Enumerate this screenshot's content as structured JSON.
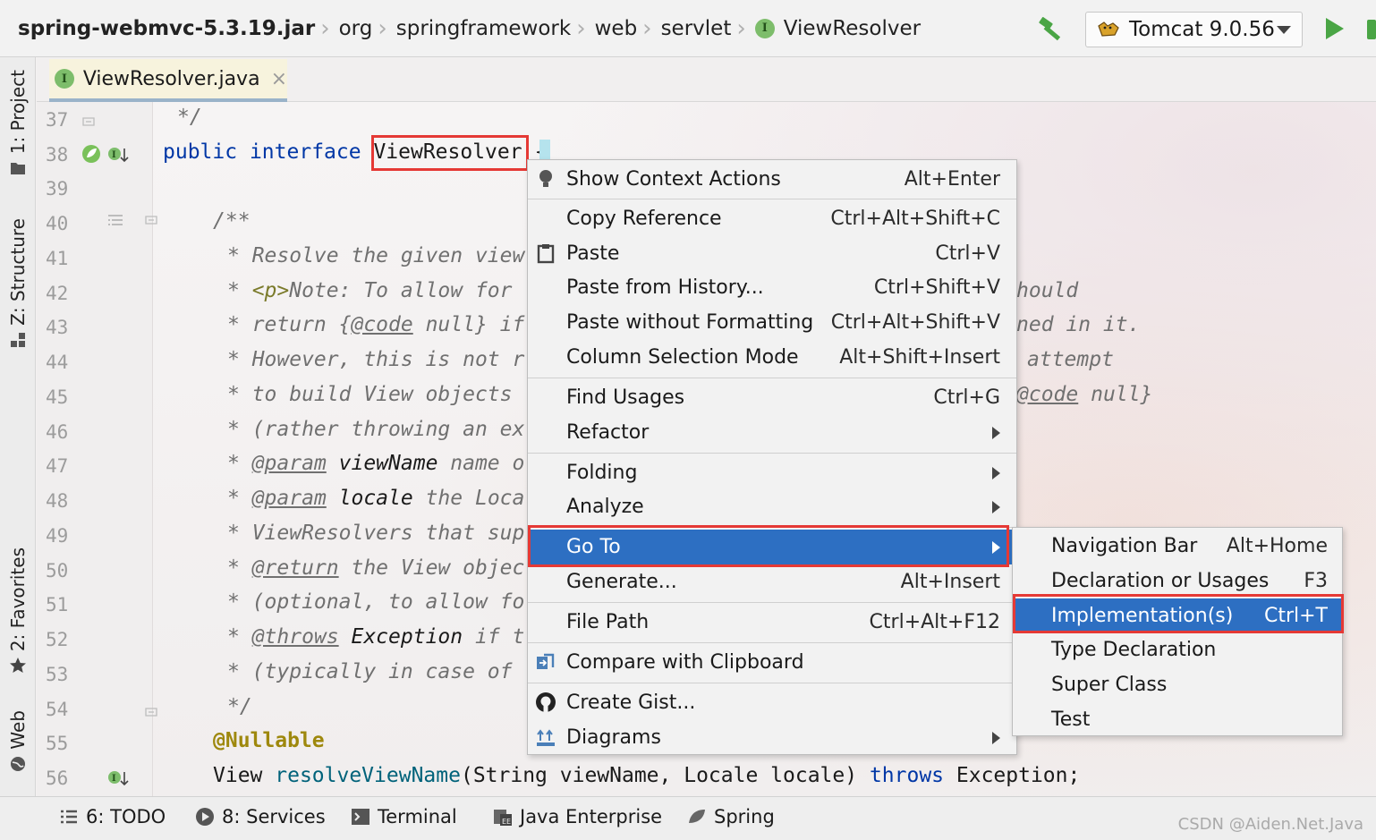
{
  "breadcrumb": {
    "items": [
      "spring-webmvc-5.3.19.jar",
      "org",
      "springframework",
      "web",
      "servlet",
      "ViewResolver"
    ],
    "iface_badge": "I"
  },
  "toolbar": {
    "run_config": "Tomcat 9.0.56"
  },
  "left_tabs": {
    "project": "1: Project",
    "structure": "Z: Structure",
    "favorites": "2: Favorites",
    "web": "Web"
  },
  "editor": {
    "tab_title": "ViewResolver.java",
    "tab_close": "×",
    "line_numbers": [
      "37",
      "38",
      "39",
      "40",
      "41",
      "42",
      "43",
      "44",
      "45",
      "46",
      "47",
      "48",
      "49",
      "50",
      "51",
      "52",
      "53",
      "54",
      "55",
      "56"
    ],
    "lines": {
      "l37": "*/",
      "l38_kw1": "public",
      "l38_kw2": "interface",
      "l38_name": "ViewResolver",
      "l38_brace": "{",
      "l40": "/**",
      "l41": "* Resolve the given view",
      "l42_a": "* ",
      "l42_tag": "<p>",
      "l42_b": "Note: To allow for",
      "l42_tail": "hould",
      "l43_a": "* return {",
      "l43_code": "@code",
      "l43_b": " null} if",
      "l43_tail": "ned in it.",
      "l44": "* However, this is not r",
      "l44_tail": "attempt",
      "l45": "* to build View objects",
      "l45_tail_code": "@code",
      "l45_tail_rest": " null}",
      "l46": "* (rather throwing an ex",
      "l47_a": "* ",
      "l47_tag": "@param",
      "l47_b": " viewName",
      "l47_c": " name o",
      "l48_a": "* ",
      "l48_tag": "@param",
      "l48_b": " locale",
      "l48_c": " the Loca",
      "l49": "* ViewResolvers that sup",
      "l50_a": "* ",
      "l50_tag": "@return",
      "l50_b": " the View objec",
      "l51": "* (optional, to allow fo",
      "l52_a": "* ",
      "l52_tag": "@throws",
      "l52_b": " Exception",
      "l52_c": " if t",
      "l53": "* (typically in case of",
      "l54": "*/",
      "l55": "@Nullable",
      "l56_a": "View ",
      "l56_method": "resolveViewName",
      "l56_b": "(String viewName, Locale locale) ",
      "l56_kw": "throws",
      "l56_c": " Exception;"
    }
  },
  "context_menu": {
    "items": [
      {
        "label": "Show Context Actions",
        "shortcut": "Alt+Enter"
      },
      {
        "label": "Copy Reference",
        "shortcut": "Ctrl+Alt+Shift+C"
      },
      {
        "label": "Paste",
        "shortcut": "Ctrl+V"
      },
      {
        "label": "Paste from History...",
        "shortcut": "Ctrl+Shift+V"
      },
      {
        "label": "Paste without Formatting",
        "shortcut": "Ctrl+Alt+Shift+V"
      },
      {
        "label": "Column Selection Mode",
        "shortcut": "Alt+Shift+Insert"
      },
      {
        "label": "Find Usages",
        "shortcut": "Ctrl+G"
      },
      {
        "label": "Refactor",
        "shortcut": ""
      },
      {
        "label": "Folding",
        "shortcut": ""
      },
      {
        "label": "Analyze",
        "shortcut": ""
      },
      {
        "label": "Go To",
        "shortcut": ""
      },
      {
        "label": "Generate...",
        "shortcut": "Alt+Insert"
      },
      {
        "label": "File Path",
        "shortcut": "Ctrl+Alt+F12"
      },
      {
        "label": "Compare with Clipboard",
        "shortcut": ""
      },
      {
        "label": "Create Gist...",
        "shortcut": ""
      },
      {
        "label": "Diagrams",
        "shortcut": ""
      }
    ]
  },
  "goto_submenu": {
    "items": [
      {
        "label": "Navigation Bar",
        "shortcut": "Alt+Home"
      },
      {
        "label": "Declaration or Usages",
        "shortcut": "F3"
      },
      {
        "label": "Implementation(s)",
        "shortcut": "Ctrl+T"
      },
      {
        "label": "Type Declaration",
        "shortcut": ""
      },
      {
        "label": "Super Class",
        "shortcut": ""
      },
      {
        "label": "Test",
        "shortcut": ""
      }
    ]
  },
  "bottom_tabs": {
    "todo": "6: TODO",
    "services": "8: Services",
    "terminal": "Terminal",
    "java_enterprise": "Java Enterprise",
    "spring": "Spring"
  },
  "watermark": "CSDN @Aiden.Net.Java",
  "colors": {
    "selection": "#2d6fc2",
    "highlight_box": "#e53935",
    "keyword": "#0037a6",
    "run_green": "#4aa545"
  }
}
